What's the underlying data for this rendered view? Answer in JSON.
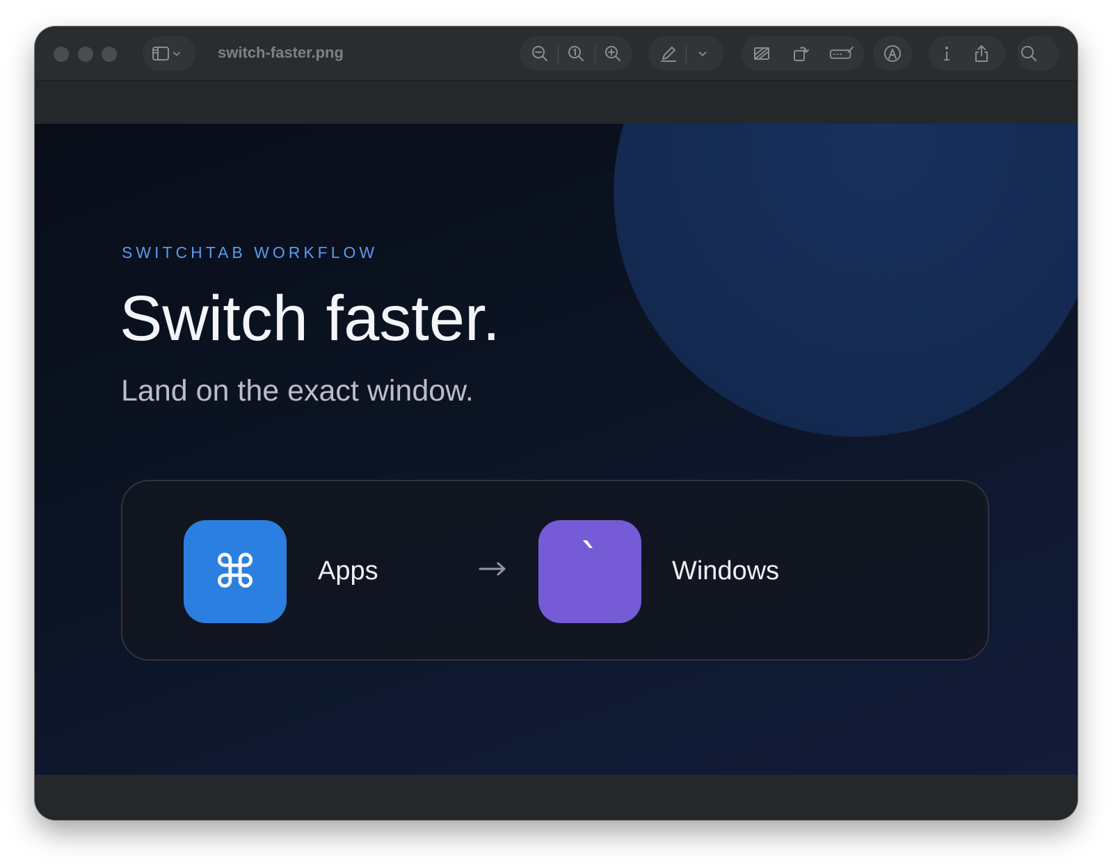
{
  "window": {
    "title": "switch-faster.png"
  },
  "toolbar": {
    "icons": [
      "sidebar-icon",
      "chevron-down-icon",
      "zoom-out-icon",
      "actual-size-icon",
      "zoom-in-icon",
      "markup-pen-icon",
      "chevron-down-icon",
      "crop-icon",
      "rotate-icon",
      "adjust-size-icon",
      "annotate-icon",
      "info-icon",
      "share-icon",
      "search-icon"
    ]
  },
  "content": {
    "kicker": "SWITCHTAB WORKFLOW",
    "headline": "Switch faster.",
    "subhead": "Land on the exact window.",
    "shortcut": {
      "first_key": "⌘",
      "first_label": "Apps",
      "second_key": "`",
      "second_label": "Windows"
    }
  },
  "colors": {
    "accent_blue": "#2b7fe0",
    "accent_purple": "#755cd6",
    "kicker": "#5b9bf2"
  }
}
